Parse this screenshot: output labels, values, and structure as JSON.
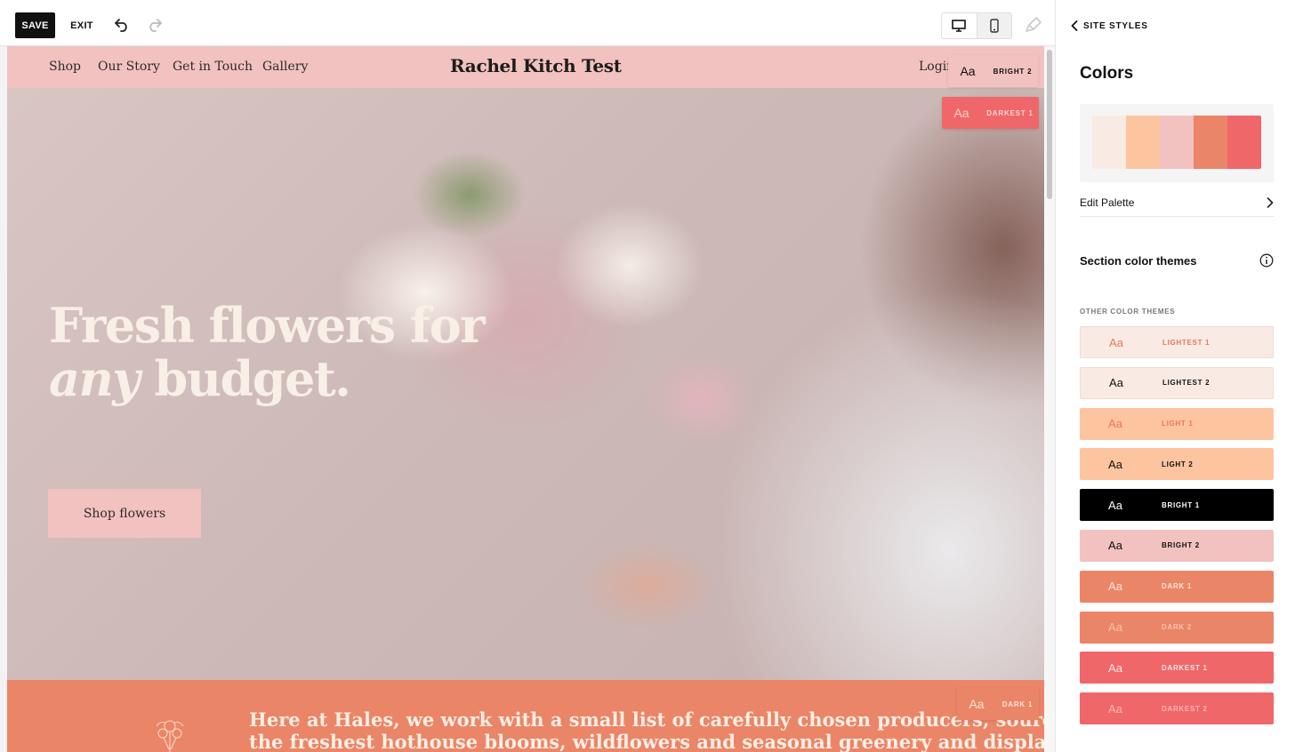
{
  "toolbar": {
    "save_label": "SAVE",
    "exit_label": "EXIT"
  },
  "site": {
    "nav": [
      "Shop",
      "Our Story",
      "Get in Touch",
      "Gallery"
    ],
    "title": "Rachel Kitch Test",
    "login": "Login"
  },
  "chips": {
    "header": {
      "aa": "Aa",
      "label": "BRIGHT 2",
      "bg": "#f2c2c0",
      "fg": "#111111"
    },
    "hero": {
      "aa": "Aa",
      "label": "DARKEST 1",
      "bg": "#f0676a",
      "fg": "#fbd4d0"
    },
    "about": {
      "aa": "Aa",
      "label": "DARK 1",
      "bg": "#eb8567",
      "fg": "#fbe3d8"
    }
  },
  "hero": {
    "line1": "Fresh flowers for",
    "line2_em": "any",
    "line2_rest": " budget.",
    "cta": "Shop flowers"
  },
  "about": {
    "line1": "Here at Hales, we work with a small list of carefully chosen producers, source",
    "line2": "the freshest hothouse blooms, wildflowers and seasonal greenery and display"
  },
  "panel": {
    "back_label": "SITE STYLES",
    "title": "Colors",
    "palette": [
      "#f9ebe3",
      "#fdc4a0",
      "#f2c2c0",
      "#eb8567",
      "#f0676a"
    ],
    "edit_palette": "Edit Palette",
    "section_themes": "Section color themes",
    "other_label": "OTHER COLOR THEMES",
    "themes": [
      {
        "aa": "Aa",
        "label": "LIGHTEST 1",
        "bg": "#f9ebe3",
        "fg": "#e8765f"
      },
      {
        "aa": "Aa",
        "label": "LIGHTEST 2",
        "bg": "#f9ebe3",
        "fg": "#111111"
      },
      {
        "aa": "Aa",
        "label": "LIGHT 1",
        "bg": "#fdc4a0",
        "fg": "#e8765f"
      },
      {
        "aa": "Aa",
        "label": "LIGHT 2",
        "bg": "#fdc4a0",
        "fg": "#111111"
      },
      {
        "aa": "Aa",
        "label": "BRIGHT 1",
        "bg": "#000000",
        "fg": "#ffffff"
      },
      {
        "aa": "Aa",
        "label": "BRIGHT 2",
        "bg": "#f2c2c0",
        "fg": "#111111"
      },
      {
        "aa": "Aa",
        "label": "DARK 1",
        "bg": "#eb8567",
        "fg": "#fde6da"
      },
      {
        "aa": "Aa",
        "label": "DARK 2",
        "bg": "#eb8567",
        "fg": "#f7c3ad"
      },
      {
        "aa": "Aa",
        "label": "DARKEST 1",
        "bg": "#f0676a",
        "fg": "#fde6e4"
      },
      {
        "aa": "Aa",
        "label": "DARKEST 2",
        "bg": "#f0676a",
        "fg": "#f9b8b5"
      }
    ]
  }
}
